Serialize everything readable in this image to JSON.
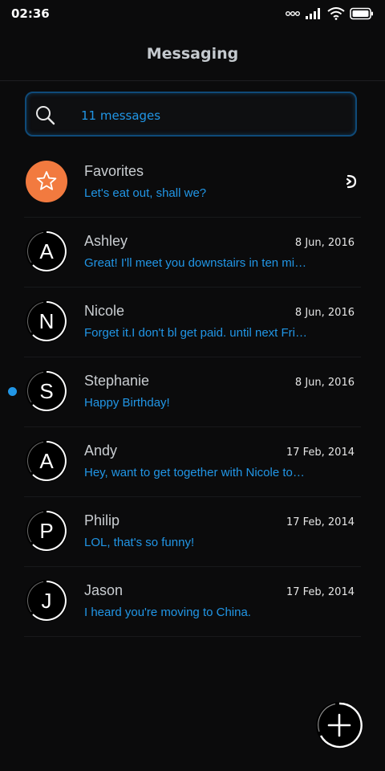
{
  "status_bar": {
    "time": "02:36",
    "icons": [
      "voicemail-icon",
      "signal-icon",
      "wifi-icon",
      "battery-icon"
    ]
  },
  "header": {
    "title": "Messaging"
  },
  "search": {
    "text": "11 messages",
    "icon": "search-icon"
  },
  "colors": {
    "accent": "#2196e6",
    "favorite": "#f27a3f",
    "background": "#0b0b0c"
  },
  "conversations": [
    {
      "name": "Favorites",
      "date": "",
      "preview": "Let's eat out, shall we?",
      "letter": "",
      "favorite": true,
      "unread": false
    },
    {
      "name": "Ashley",
      "date": "8 Jun, 2016",
      "preview": "Great! I'll meet you downstairs in ten minutes.",
      "letter": "A",
      "favorite": false,
      "unread": false
    },
    {
      "name": "Nicole",
      "date": "8 Jun, 2016",
      "preview": "Forget it.I don't bl get paid. until next Friday.",
      "letter": "N",
      "favorite": false,
      "unread": false
    },
    {
      "name": "Stephanie",
      "date": "8 Jun, 2016",
      "preview": "Happy Birthday!",
      "letter": "S",
      "favorite": false,
      "unread": true
    },
    {
      "name": "Andy",
      "date": "17 Feb, 2014",
      "preview": "Hey, want to get together with Nicole tonight?",
      "letter": "A",
      "favorite": false,
      "unread": false
    },
    {
      "name": "Philip",
      "date": "17 Feb, 2014",
      "preview": "LOL, that's so funny!",
      "letter": "P",
      "favorite": false,
      "unread": false
    },
    {
      "name": "Jason",
      "date": "17 Feb, 2014",
      "preview": "I heard you're moving to China.",
      "letter": "J",
      "favorite": false,
      "unread": false
    }
  ],
  "fab": {
    "icon": "plus-icon"
  }
}
